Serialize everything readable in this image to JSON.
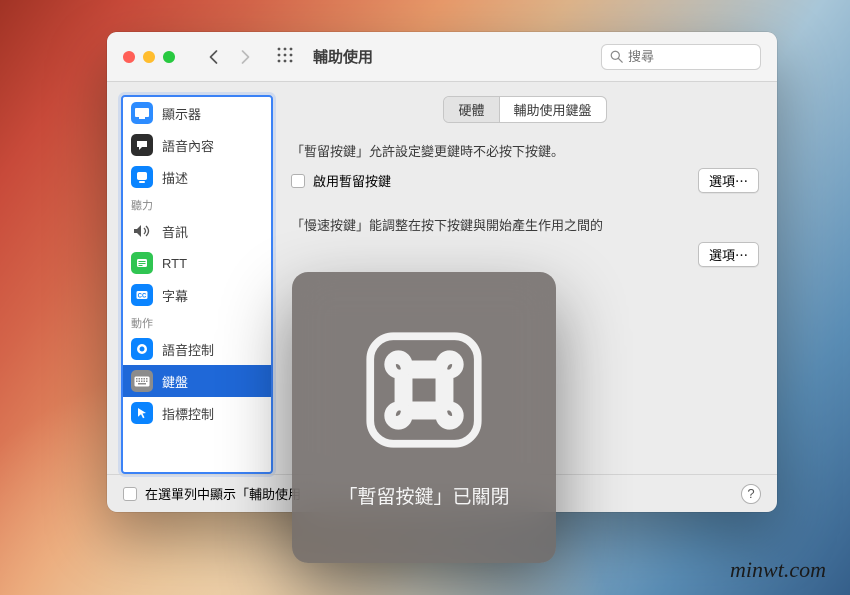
{
  "window": {
    "title": "輔助使用"
  },
  "search": {
    "placeholder": "搜尋"
  },
  "sidebar": {
    "items": [
      {
        "label": "顯示器",
        "icon": "display",
        "bg": "#2790ff"
      },
      {
        "label": "語音內容",
        "icon": "speech",
        "bg": "#2d2d2d"
      },
      {
        "label": "描述",
        "icon": "describe",
        "bg": "#0a84ff"
      }
    ],
    "cat1": "聽力",
    "items2": [
      {
        "label": "音訊",
        "icon": "audio",
        "bg": "transparent"
      },
      {
        "label": "RTT",
        "icon": "rtt",
        "bg": "#30c552"
      },
      {
        "label": "字幕",
        "icon": "caption",
        "bg": "#0a84ff"
      }
    ],
    "cat2": "動作",
    "items3": [
      {
        "label": "語音控制",
        "icon": "voice",
        "bg": "#0a84ff"
      },
      {
        "label": "鍵盤",
        "icon": "keyboard",
        "bg": "#808080",
        "selected": true
      },
      {
        "label": "指標控制",
        "icon": "pointer",
        "bg": "#0a84ff"
      }
    ]
  },
  "tabs": {
    "t1": "硬體",
    "t2": "輔助使用鍵盤"
  },
  "sticky": {
    "desc": "「暫留按鍵」允許設定變更鍵時不必按下按鍵。",
    "chklabel": "啟用暫留按鍵",
    "options": "選項⋯"
  },
  "slow": {
    "desc": "「慢速按鍵」能調整在按下按鍵與開始產生作用之間的",
    "options": "選項⋯"
  },
  "bottom": {
    "chklabel": "在選單列中顯示「輔助使用"
  },
  "overlay": {
    "text": "「暫留按鍵」已關閉"
  },
  "watermark": "minwt.com"
}
